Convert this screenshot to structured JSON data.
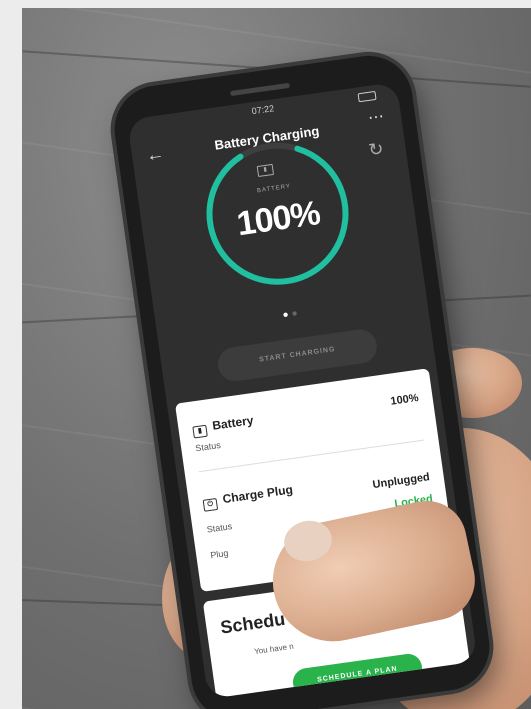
{
  "status_bar": {
    "time": "07:22"
  },
  "app_bar": {
    "back_icon": "arrow-left-icon",
    "title": "Battery Charging",
    "more_icon": "more-dots-icon",
    "refresh_icon": "refresh-icon"
  },
  "gauge": {
    "label": "BATTERY",
    "percent_text": "100%",
    "level": 1.0,
    "accent_color": "#1fbf9f"
  },
  "pager": {
    "count": 2,
    "active": 0
  },
  "start_button": {
    "label": "START CHARGING"
  },
  "info_card": {
    "battery": {
      "title": "Battery",
      "status_label": "Status",
      "status_value": "100%"
    },
    "charge_plug": {
      "title": "Charge Plug",
      "status_label": "Status",
      "status_value": "Unplugged",
      "plug_label": "Plug",
      "plug_value": "Locked",
      "plug_value_color": "#2ab24b"
    }
  },
  "schedule_card": {
    "title": "Schedu",
    "text": "You have n",
    "button_label": "SCHEDULE A PLAN",
    "button_color": "#2ab24b"
  }
}
